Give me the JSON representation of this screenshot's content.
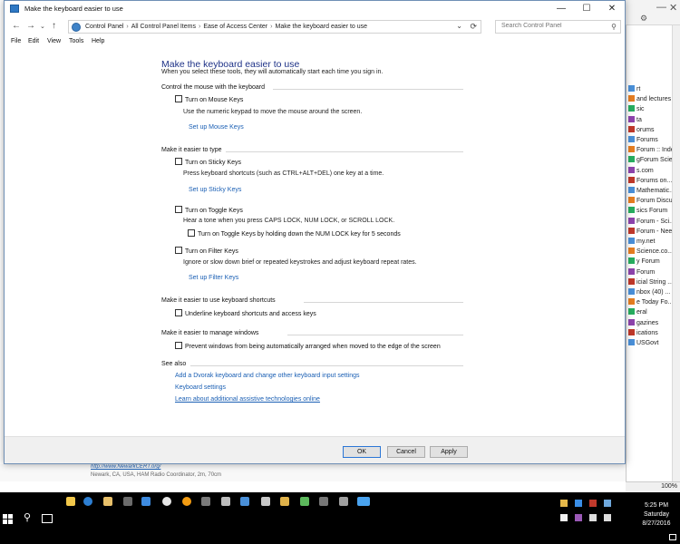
{
  "window": {
    "title": "Make the keyboard easier to use",
    "breadcrumbs": [
      "Control Panel",
      "All Control Panel Items",
      "Ease of Access Center",
      "Make the keyboard easier to use"
    ],
    "search_placeholder": "Search Control Panel",
    "menu": [
      "File",
      "Edit",
      "View",
      "Tools",
      "Help"
    ]
  },
  "content": {
    "heading": "Make the keyboard easier to use",
    "subheading": "When you select these tools, they will automatically start each time you sign in.",
    "mouse": {
      "header": "Control the mouse with the keyboard",
      "mouse_keys_label": "Turn on Mouse Keys",
      "mouse_keys_desc": "Use the numeric keypad to move the mouse around the screen.",
      "mouse_keys_link": "Set up Mouse Keys"
    },
    "typing": {
      "header": "Make it easier to type",
      "sticky_label": "Turn on Sticky Keys",
      "sticky_desc": "Press keyboard shortcuts (such as CTRL+ALT+DEL) one key at a time.",
      "sticky_link": "Set up Sticky Keys",
      "toggle_label": "Turn on Toggle Keys",
      "toggle_desc": "Hear a tone when you press CAPS LOCK, NUM LOCK, or SCROLL LOCK.",
      "toggle_hold_label": "Turn on Toggle Keys by holding down the NUM LOCK key for 5 seconds",
      "filter_label": "Turn on Filter Keys",
      "filter_desc": "Ignore or slow down brief or repeated keystrokes and adjust keyboard repeat rates.",
      "filter_link": "Set up Filter Keys"
    },
    "shortcuts": {
      "header": "Make it easier to use keyboard shortcuts",
      "underline_label": "Underline keyboard shortcuts and access keys"
    },
    "windows": {
      "header": "Make it easier to manage windows",
      "prevent_label": "Prevent windows from being automatically arranged when moved to the edge of the screen"
    },
    "see_also": {
      "header": "See also",
      "dvorak_link": "Add a Dvorak keyboard and change other keyboard input settings",
      "keyboard_settings_link": "Keyboard settings",
      "learn_more_link": "Learn about additional assistive technologies online"
    }
  },
  "buttons": {
    "ok": "OK",
    "cancel": "Cancel",
    "apply": "Apply"
  },
  "background": {
    "side_items": [
      "rt",
      "and lectures",
      "sic",
      "ta",
      "orums",
      "Forums",
      "Forum :: Index",
      "gForum Scie...",
      "s.com",
      "Forums on...",
      "Mathematic...",
      "Forum Discu...",
      "sics Forum",
      "Forum - Sci...",
      "Forum - Nee...",
      "my.net",
      "Science.co...",
      "y Forum",
      "Forum",
      "icial String ...",
      "nbox (40) ...",
      "e Today Fo...",
      "eral",
      "gazines",
      "ications",
      "USGovt"
    ],
    "lower_link": "http://www.NewarkCERT.org/",
    "lower_sub": "Newark, CA, USA, HAM Radio Coordinator, 2m, 70cm",
    "zoom": "100%"
  },
  "taskbar": {
    "time": "5:25 PM",
    "day": "Saturday",
    "date": "8/27/2016"
  },
  "colors": {
    "heading": "#1e3287",
    "link": "#1a5fb4",
    "taskbar": "#000000"
  }
}
